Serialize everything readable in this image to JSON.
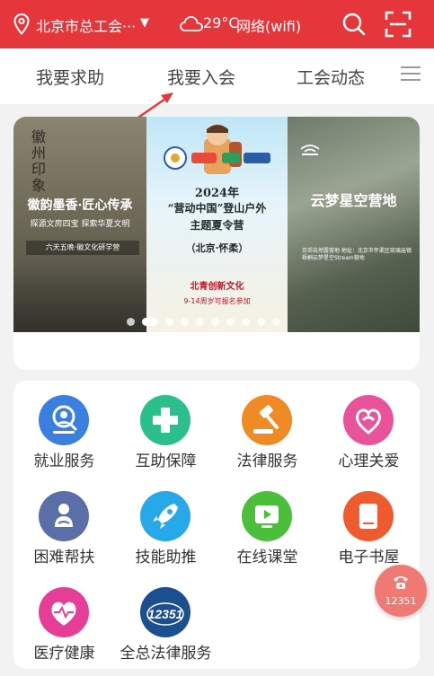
{
  "header": {
    "location": "北京市总工会···",
    "temperature": "29°C",
    "network": "网络(wifi)",
    "icons": [
      "location-pin-icon",
      "caret-down-icon",
      "cloud-icon",
      "search-icon",
      "scan-icon"
    ]
  },
  "tabs": [
    {
      "label": "我要求助"
    },
    {
      "label": "我要入会"
    },
    {
      "label": "工会动态"
    }
  ],
  "banner": {
    "slide_a": {
      "vertical": "徽州印象",
      "title": "徽韵墨香·匠心传承",
      "subtitle": "探源文房四宝 探索华夏文明",
      "tag": "六天五晚·徽文化研学营"
    },
    "slide_b": {
      "year": "2024年",
      "line2": "“营动中国”登山户外",
      "line3": "主题夏令营",
      "line4": "（北京·怀柔）",
      "brand": "北青创新文化",
      "date": "9-14周岁可报名参加"
    },
    "slide_c": {
      "title": "云梦星空营地",
      "info": "京郊自然露营地 地址：北京市怀柔区琉璃庙镇梧桐云梦星空Stream营地"
    },
    "dots_count": 10,
    "active_dot": 1
  },
  "services": [
    {
      "label": "就业服务",
      "icon": "employment-icon",
      "color": "#3b7fe0"
    },
    {
      "label": "互助保障",
      "icon": "medical-cross-icon",
      "color": "#2bbf8c"
    },
    {
      "label": "法律服务",
      "icon": "gavel-icon",
      "color": "#f08a24"
    },
    {
      "label": "心理关爱",
      "icon": "heart-swirl-icon",
      "color": "#e8539b"
    },
    {
      "label": "困难帮扶",
      "icon": "helping-hand-icon",
      "color": "#5a6fa8"
    },
    {
      "label": "技能助推",
      "icon": "rocket-icon",
      "color": "#27a8e8"
    },
    {
      "label": "在线课堂",
      "icon": "online-class-icon",
      "color": "#4bbf3b"
    },
    {
      "label": "电子书屋",
      "icon": "book-icon",
      "color": "#ef5a2e"
    },
    {
      "label": "医疗健康",
      "icon": "heartbeat-icon",
      "color": "#e63e96"
    },
    {
      "label": "全总法律服务",
      "icon": "hotline-12351-logo",
      "color": "#1b4f8f",
      "logo_text": "12351"
    }
  ],
  "hotline": {
    "number": "12351",
    "icon": "telephone-icon",
    "color": "#f07a73"
  },
  "colors": {
    "header_bg": "#e5363c",
    "page_bg": "#f2f2f2",
    "annotation_arrow": "#e5363c"
  }
}
